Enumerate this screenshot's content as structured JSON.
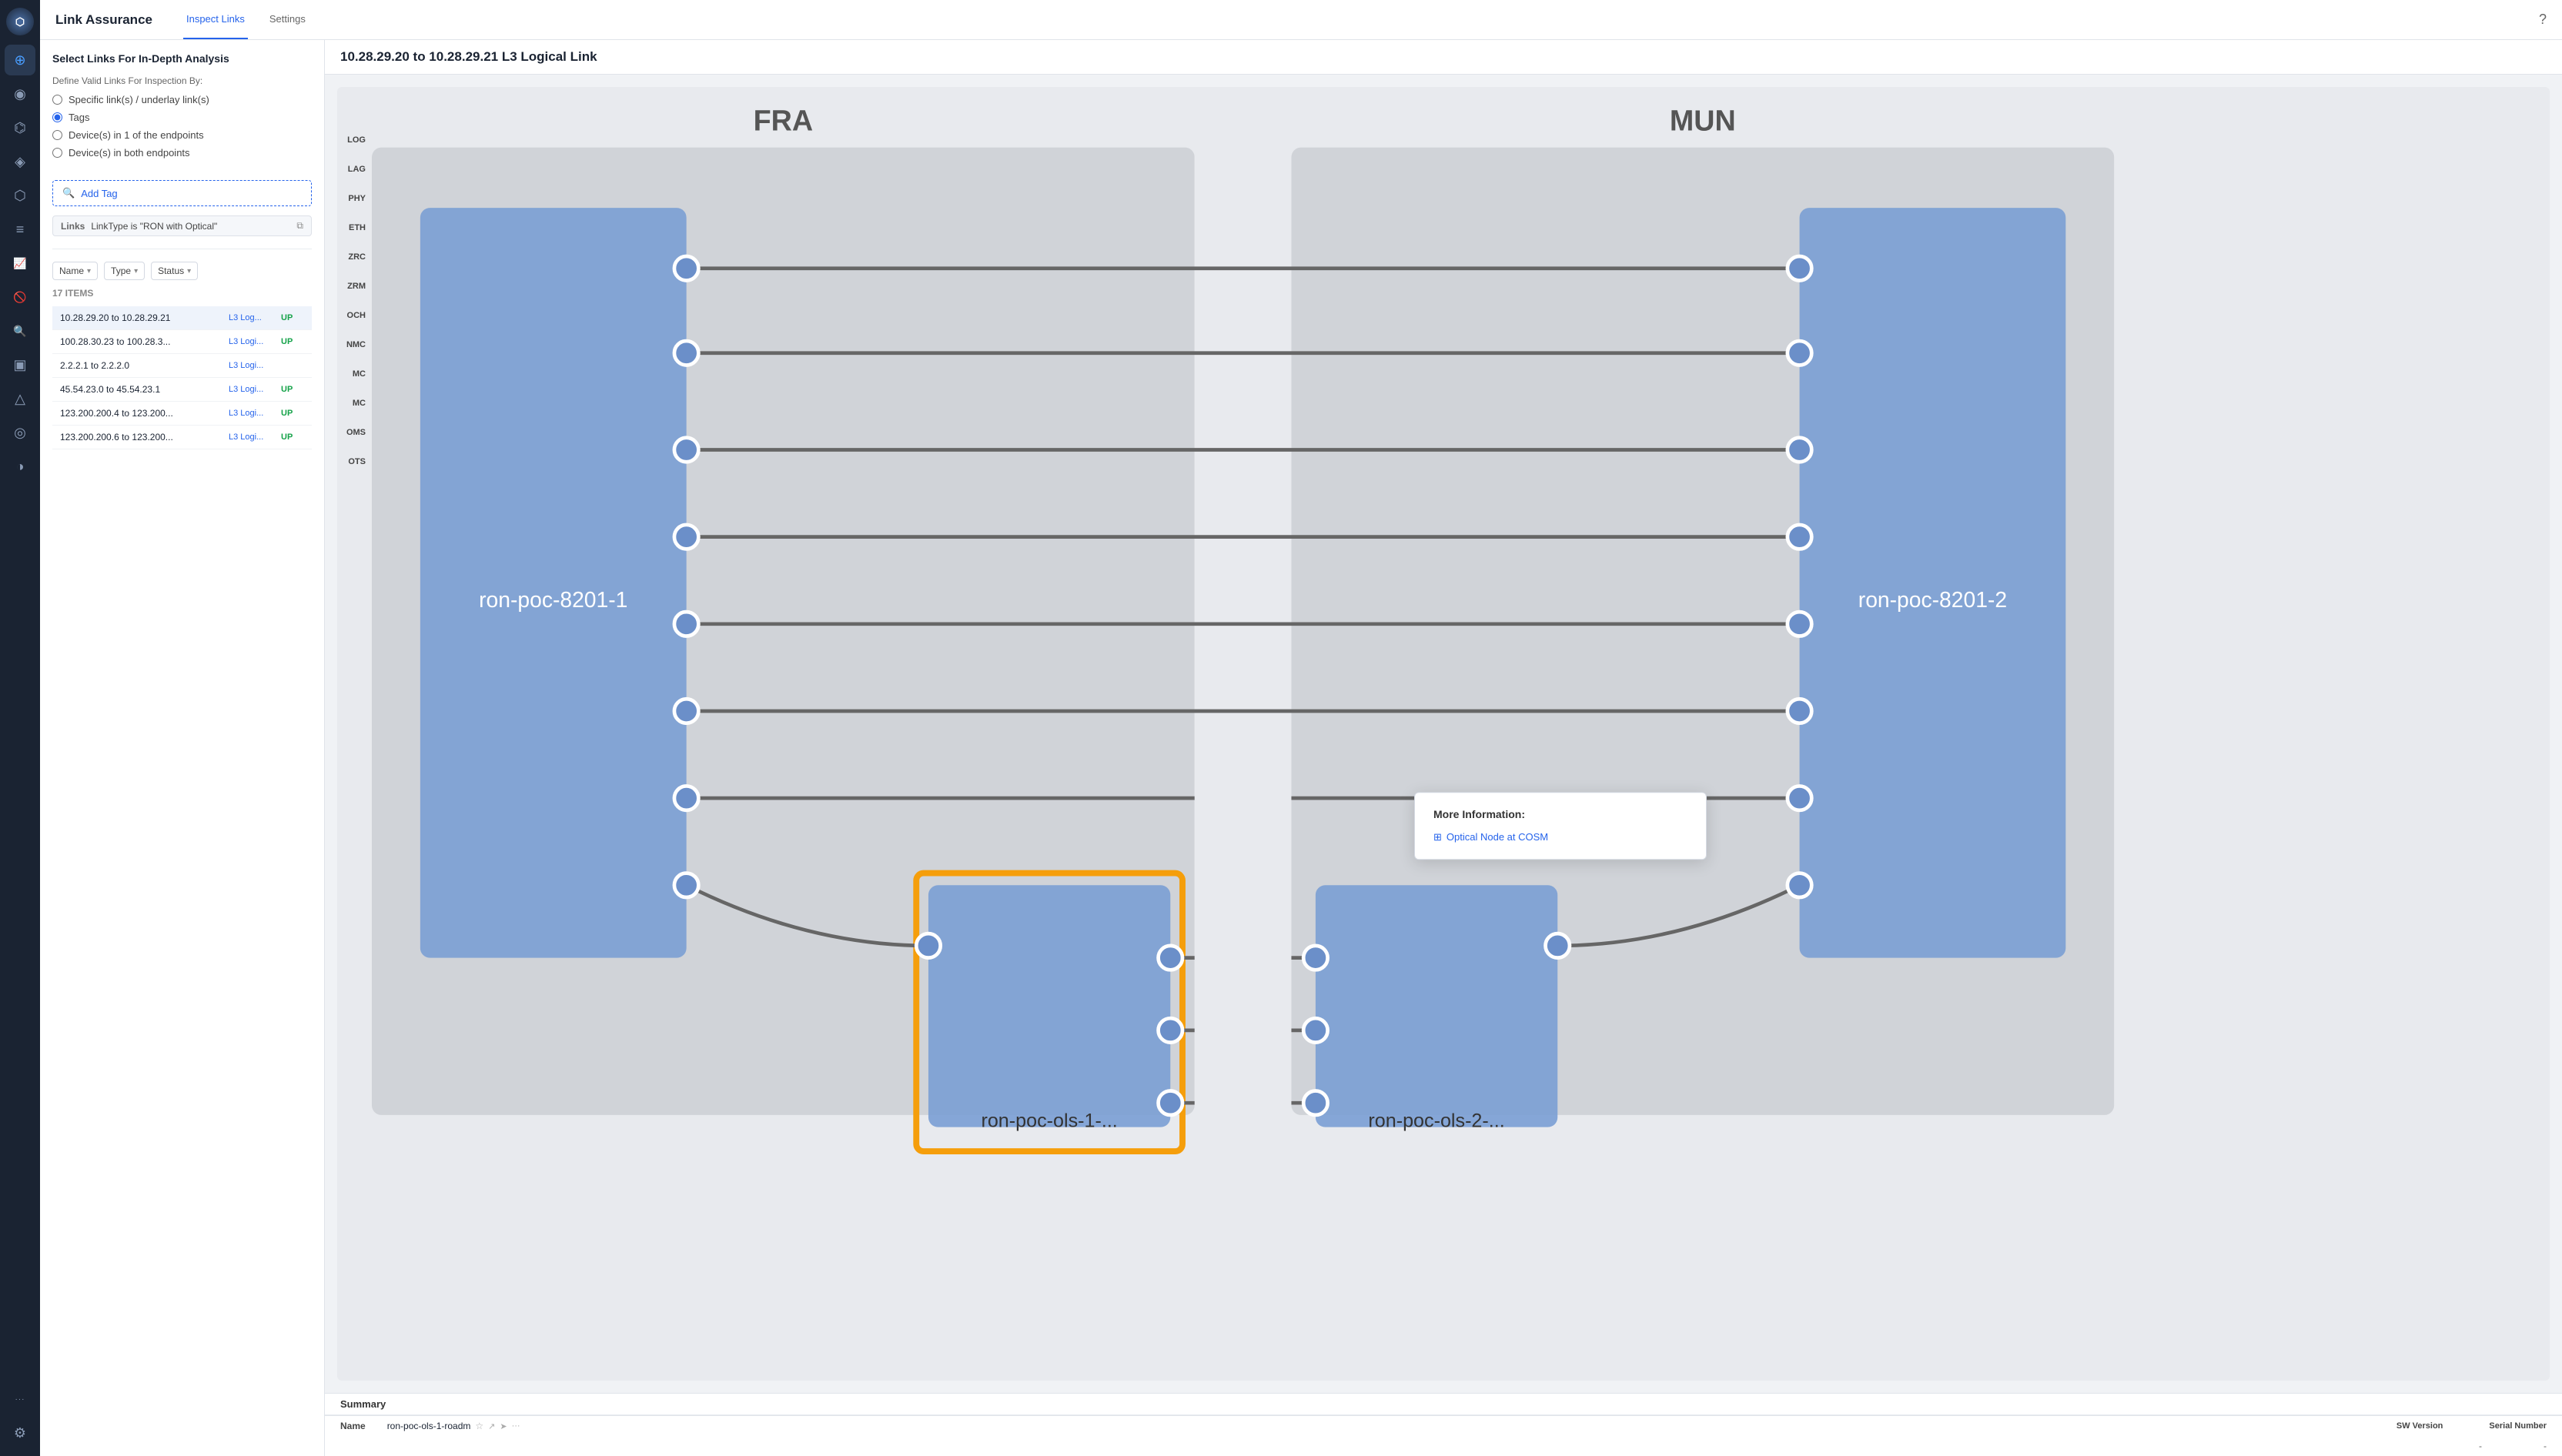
{
  "app": {
    "title": "Link Assurance",
    "help_icon": "?",
    "nav_tabs": [
      {
        "label": "Inspect Links",
        "active": true
      },
      {
        "label": "Settings",
        "active": false
      }
    ]
  },
  "sidebar": {
    "logo": "⬡",
    "items": [
      {
        "icon": "⊕",
        "name": "home",
        "active": false
      },
      {
        "icon": "◉",
        "name": "circle-icon",
        "active": true
      },
      {
        "icon": "⌬",
        "name": "topology-icon",
        "active": false
      },
      {
        "icon": "◈",
        "name": "grid-icon",
        "active": false
      },
      {
        "icon": "⬡",
        "name": "hex-icon",
        "active": false
      },
      {
        "icon": "≡",
        "name": "layers-icon",
        "active": false
      },
      {
        "icon": "📈",
        "name": "chart-icon",
        "active": false
      },
      {
        "icon": "🚫",
        "name": "block-icon",
        "active": false
      },
      {
        "icon": "🔍",
        "name": "search-icon",
        "active": false
      },
      {
        "icon": "▣",
        "name": "square-icon",
        "active": false
      },
      {
        "icon": "△",
        "name": "triangle-icon",
        "active": false
      },
      {
        "icon": "◎",
        "name": "target-icon",
        "active": false
      },
      {
        "icon": "◑",
        "name": "half-circle-icon",
        "active": false
      }
    ],
    "bottom_items": [
      {
        "icon": "···",
        "name": "more-icon"
      },
      {
        "icon": "⚙",
        "name": "settings-icon"
      }
    ]
  },
  "left_panel": {
    "title": "Select Links For In-Depth Analysis",
    "filter_section": {
      "label": "Define Valid Links For Inspection By:",
      "options": [
        {
          "label": "Specific link(s) / underlay link(s)",
          "selected": false
        },
        {
          "label": "Tags",
          "selected": true
        },
        {
          "label": "Device(s) in 1 of the endpoints",
          "selected": false
        },
        {
          "label": "Device(s) in both endpoints",
          "selected": false
        }
      ]
    },
    "add_tag_button": "Add Tag",
    "tag_filter": {
      "label": "Links",
      "value": "LinkType is \"RON with Optical\""
    },
    "filter_dropdowns": [
      {
        "label": "Name",
        "name": "name-filter"
      },
      {
        "label": "Type",
        "name": "type-filter"
      },
      {
        "label": "Status",
        "name": "status-filter"
      }
    ],
    "items_count": "17 ITEMS",
    "links": [
      {
        "name": "10.28.29.20 to 10.28.29.21",
        "type": "L3 Log...",
        "status": "UP",
        "selected": true
      },
      {
        "name": "100.28.30.23 to 100.28.3...",
        "type": "L3 Logi...",
        "status": "UP",
        "selected": false
      },
      {
        "name": "2.2.2.1 to 2.2.2.0",
        "type": "L3 Logi...",
        "status": "",
        "selected": false
      },
      {
        "name": "45.54.23.0 to 45.54.23.1",
        "type": "L3 Logi...",
        "status": "UP",
        "selected": false
      },
      {
        "name": "123.200.200.4 to 123.200...",
        "type": "L3 Logi...",
        "status": "UP",
        "selected": false
      },
      {
        "name": "123.200.200.6 to 123.200...",
        "type": "L3 Logi...",
        "status": "UP",
        "selected": false
      }
    ]
  },
  "main_diagram": {
    "title": "10.28.29.20 to 10.28.29.21 L3 Logical Link",
    "fra_label": "FRA",
    "mun_label": "MUN",
    "node_left": "ron-poc-8201-1",
    "node_right": "ron-poc-8201-2",
    "node_ols_left": "ron-poc-ols-1-...",
    "node_ols_right": "ron-poc-ols-2-...",
    "layers": [
      "LOG",
      "LAG",
      "PHY",
      "ETH",
      "ZRC",
      "ZRM",
      "OCH",
      "NMC",
      "MC",
      "MC",
      "OMS",
      "OTS"
    ]
  },
  "popup": {
    "title": "More Information:",
    "link_text": "Optical Node at COSM",
    "link_icon": "↗"
  },
  "node_row": {
    "name": "ron-poc-ols-1-roadm",
    "star_icon": "☆",
    "external_icon": "↗",
    "nav_icon": "➤",
    "more_icon": "···"
  },
  "bottom_panel": {
    "tab_label": "Summary",
    "columns": [
      {
        "label": "Name",
        "key": "name"
      },
      {
        "label": "SW Version",
        "key": "sw_version"
      },
      {
        "label": "Serial Number",
        "key": "serial_number"
      }
    ],
    "row_placeholder_sw": "-",
    "row_placeholder_serial": "-"
  },
  "colors": {
    "accent": "#2563eb",
    "up_status": "#16a34a",
    "down_status": "#dc2626",
    "selected_bg": "#eef3fb",
    "node_blue": "#6b8fc9",
    "orange_highlight": "#f59e0b",
    "link_line": "#888",
    "region_bg": "#d4d8de"
  }
}
